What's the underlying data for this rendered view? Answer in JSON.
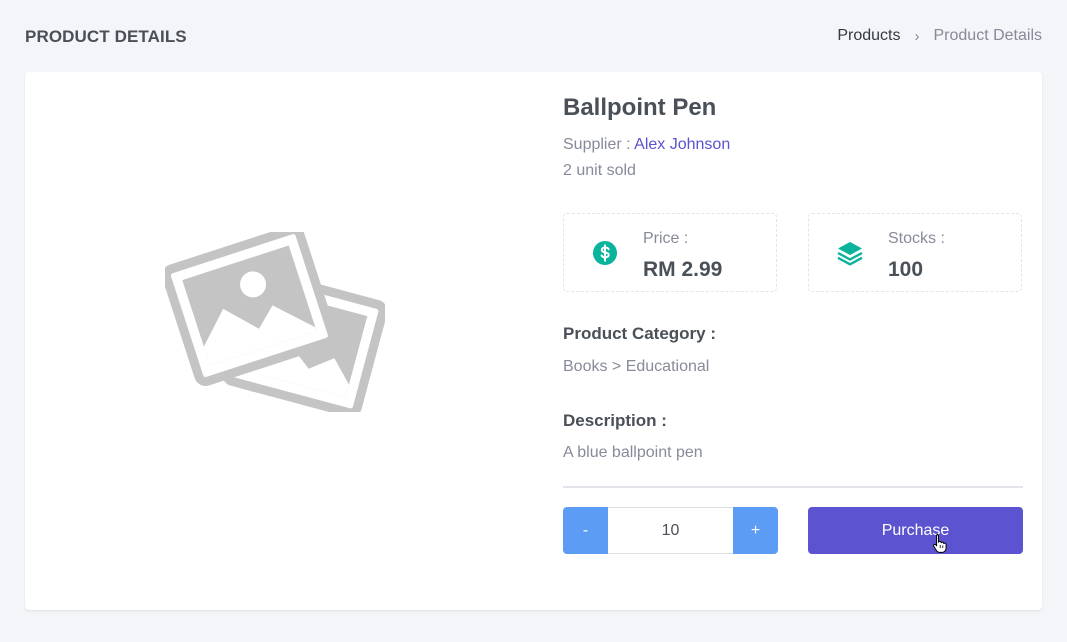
{
  "header": {
    "title": "PRODUCT DETAILS",
    "breadcrumb": {
      "parent": "Products",
      "separator": "›",
      "current": "Product Details"
    }
  },
  "product": {
    "image_icon": "image-placeholder-icon",
    "name": "Ballpoint Pen",
    "supplier_label": "Supplier :",
    "supplier_name": "Alex Johnson",
    "sold": "2 unit sold",
    "price": {
      "icon": "dollar-circle-icon",
      "label": "Price :",
      "value": "RM 2.99"
    },
    "stock": {
      "icon": "stack-layers-icon",
      "label": "Stocks :",
      "value": "100"
    },
    "category": {
      "title": "Product Category :",
      "value": "Books > Educational"
    },
    "description": {
      "title": "Description :",
      "value": "A blue ballpoint pen"
    }
  },
  "purchase": {
    "minus_label": "-",
    "plus_label": "+",
    "quantity": "10",
    "button_label": "Purchase"
  },
  "colors": {
    "accent": "#5b53cf",
    "qty_button": "#5c9cf5",
    "stat_icon": "#0ab39c"
  }
}
